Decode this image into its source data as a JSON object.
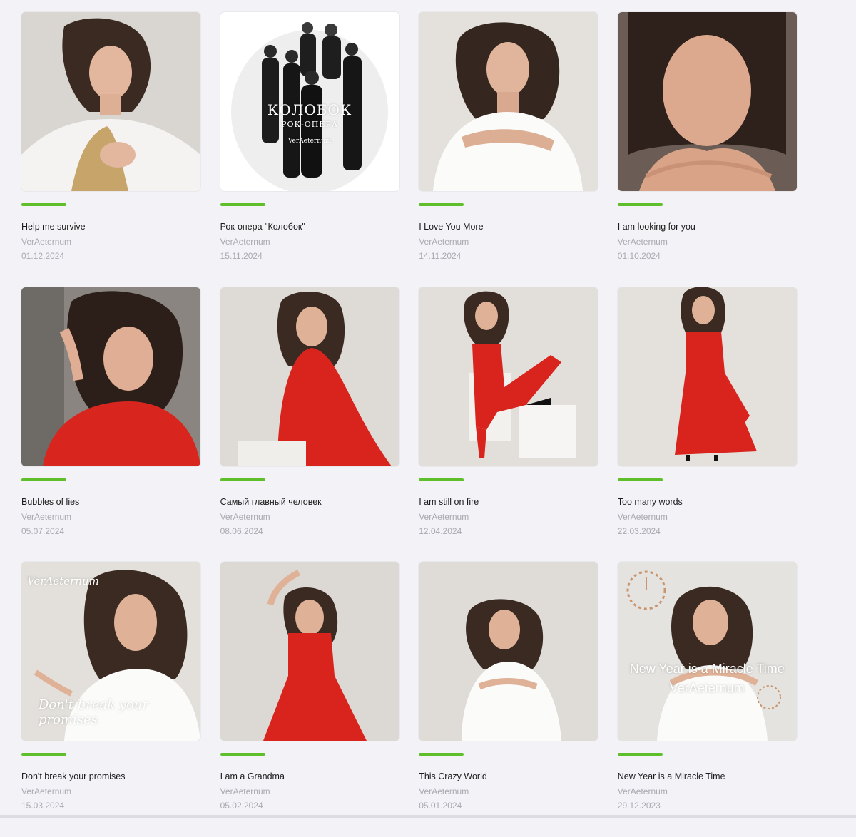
{
  "accent_color": "#5fbf2a",
  "albums": [
    {
      "title": "Help me survive",
      "artist": "VerAeternum",
      "date": "01.12.2024",
      "cover_style": "white-dress-wheat"
    },
    {
      "title": "Рок-опера \"Колобок\"",
      "artist": "VerAeternum",
      "date": "15.11.2024",
      "cover_style": "group-bw",
      "overlay": {
        "title": "КОЛОБОК",
        "subtitle": "РОК-ОПЕРА",
        "brand": "VerAeternum"
      }
    },
    {
      "title": "I Love You More",
      "artist": "VerAeternum",
      "date": "14.11.2024",
      "cover_style": "white-dress-hug"
    },
    {
      "title": "I am looking for you",
      "artist": "VerAeternum",
      "date": "01.10.2024",
      "cover_style": "portrait-close"
    },
    {
      "title": "Bubbles of lies",
      "artist": "VerAeternum",
      "date": "05.07.2024",
      "cover_style": "red-portrait"
    },
    {
      "title": "Самый главный человек",
      "artist": "VerAeternum",
      "date": "08.06.2024",
      "cover_style": "red-sitting"
    },
    {
      "title": "I am still on fire",
      "artist": "VerAeternum",
      "date": "12.04.2024",
      "cover_style": "red-cube"
    },
    {
      "title": "Too many words",
      "artist": "VerAeternum",
      "date": "22.03.2024",
      "cover_style": "red-standing"
    },
    {
      "title": "Don't break your promises",
      "artist": "VerAeternum",
      "date": "15.03.2024",
      "cover_style": "white-offshoulder",
      "overlay": {
        "brand": "VerAeternum",
        "caption": "Don't break your promises"
      }
    },
    {
      "title": "I am a Grandma",
      "artist": "VerAeternum",
      "date": "05.02.2024",
      "cover_style": "red-dance"
    },
    {
      "title": "This Crazy World",
      "artist": "VerAeternum",
      "date": "05.01.2024",
      "cover_style": "white-sitting"
    },
    {
      "title": "New Year is a Miracle Time",
      "artist": "VerAeternum",
      "date": "29.12.2023",
      "cover_style": "white-clock",
      "overlay": {
        "line1": "New Year is a Miracle Time",
        "line2": "VerAeternum"
      }
    }
  ]
}
